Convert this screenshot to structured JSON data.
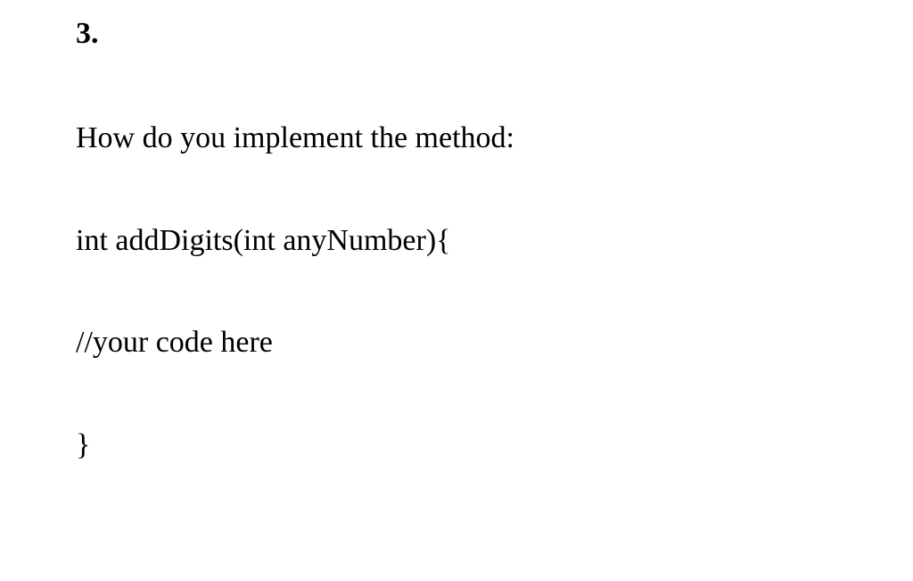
{
  "question": {
    "number": "3.",
    "prompt": "How do you implement the method:",
    "code": {
      "line1": "int addDigits(int anyNumber){",
      "line2": "//your code here",
      "line3": "}"
    }
  }
}
